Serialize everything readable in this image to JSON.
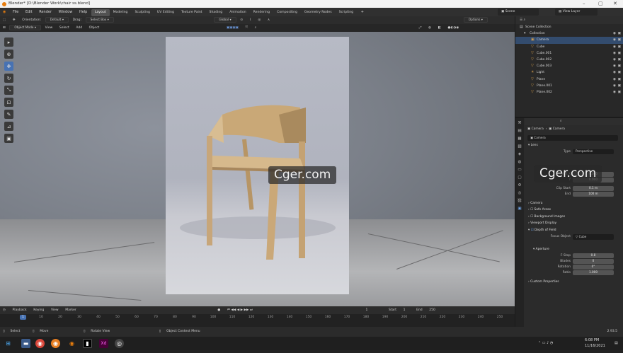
{
  "window": {
    "title": "Blender* [D:\\Blender Work\\chair ss.blend]"
  },
  "menu": {
    "items": [
      "File",
      "Edit",
      "Render",
      "Window",
      "Help"
    ]
  },
  "workspaces": [
    "Layout",
    "Modeling",
    "Sculpting",
    "UV Editing",
    "Texture Paint",
    "Shading",
    "Animation",
    "Rendering",
    "Compositing",
    "Geometry Nodes",
    "Scripting"
  ],
  "active_workspace": "Layout",
  "scene": {
    "name": "Scene",
    "view_layer": "View Layer"
  },
  "tool_header": {
    "orientation_label": "Orientation:",
    "orientation": "Default",
    "drag_label": "Drag:",
    "drag": "Select Box",
    "transform": "Global",
    "options": "Options"
  },
  "viewport_header": {
    "mode": "Object Mode",
    "menus": [
      "View",
      "Select",
      "Add",
      "Object"
    ]
  },
  "watermark": {
    "text": "Cger.com"
  },
  "outliner": {
    "root": "Scene Collection",
    "collection": "Collection",
    "objects": [
      {
        "name": "Camera",
        "icon": "camera-icon",
        "selected": true
      },
      {
        "name": "Cube",
        "icon": "mesh-icon",
        "selected": false
      },
      {
        "name": "Cube.001",
        "icon": "mesh-icon",
        "selected": false
      },
      {
        "name": "Cube.002",
        "icon": "mesh-icon",
        "selected": false
      },
      {
        "name": "Cube.003",
        "icon": "mesh-icon",
        "selected": false
      },
      {
        "name": "Light",
        "icon": "light-icon",
        "selected": false
      },
      {
        "name": "Plane",
        "icon": "mesh-icon",
        "selected": false
      },
      {
        "name": "Plane.001",
        "icon": "mesh-icon",
        "selected": false
      },
      {
        "name": "Plane.002",
        "icon": "mesh-icon",
        "selected": false
      }
    ]
  },
  "properties": {
    "breadcrumb": [
      "Camera",
      "Camera"
    ],
    "data_name": "Camera",
    "lens_header": "Lens",
    "type_label": "Type",
    "type_value": "Perspective",
    "shift_x_label": "Shift X",
    "shift_x": "0.000",
    "shift_y_label": "Y",
    "shift_y": "0.000",
    "clip_start_label": "Clip Start",
    "clip_start": "0.1 m",
    "clip_end_label": "End",
    "clip_end": "100 m",
    "camera_header": "Camera",
    "safe_areas": "Safe Areas",
    "background_images": "Background Images",
    "viewport_display": "Viewport Display",
    "dof_header": "Depth of Field",
    "focus_object_label": "Focus Object",
    "focus_object": "Cube",
    "aperture_header": "Aperture",
    "fstop_label": "F-Stop",
    "fstop": "0.8",
    "blades_label": "Blades",
    "blades": "0",
    "rotation_label": "Rotation",
    "rotation": "0°",
    "ratio_label": "Ratio",
    "ratio": "1.000",
    "custom_properties": "Custom Properties"
  },
  "timeline": {
    "menus": [
      "Playback",
      "Keying",
      "View",
      "Marker"
    ],
    "current_frame": "1",
    "start_label": "Start",
    "start": "1",
    "end_label": "End",
    "end": "250",
    "ticks": [
      "0",
      "10",
      "20",
      "30",
      "40",
      "50",
      "60",
      "70",
      "80",
      "90",
      "100",
      "110",
      "120",
      "130",
      "140",
      "150",
      "160",
      "170",
      "180",
      "190",
      "200",
      "210",
      "220",
      "230",
      "240",
      "250"
    ]
  },
  "statusbar": {
    "select": "Select",
    "move": "Move",
    "rotate": "Rotate View",
    "context": "Object Context Menu",
    "version": "2.93.5"
  },
  "taskbar": {
    "time": "6:08 PM",
    "date": "11/16/2021"
  }
}
